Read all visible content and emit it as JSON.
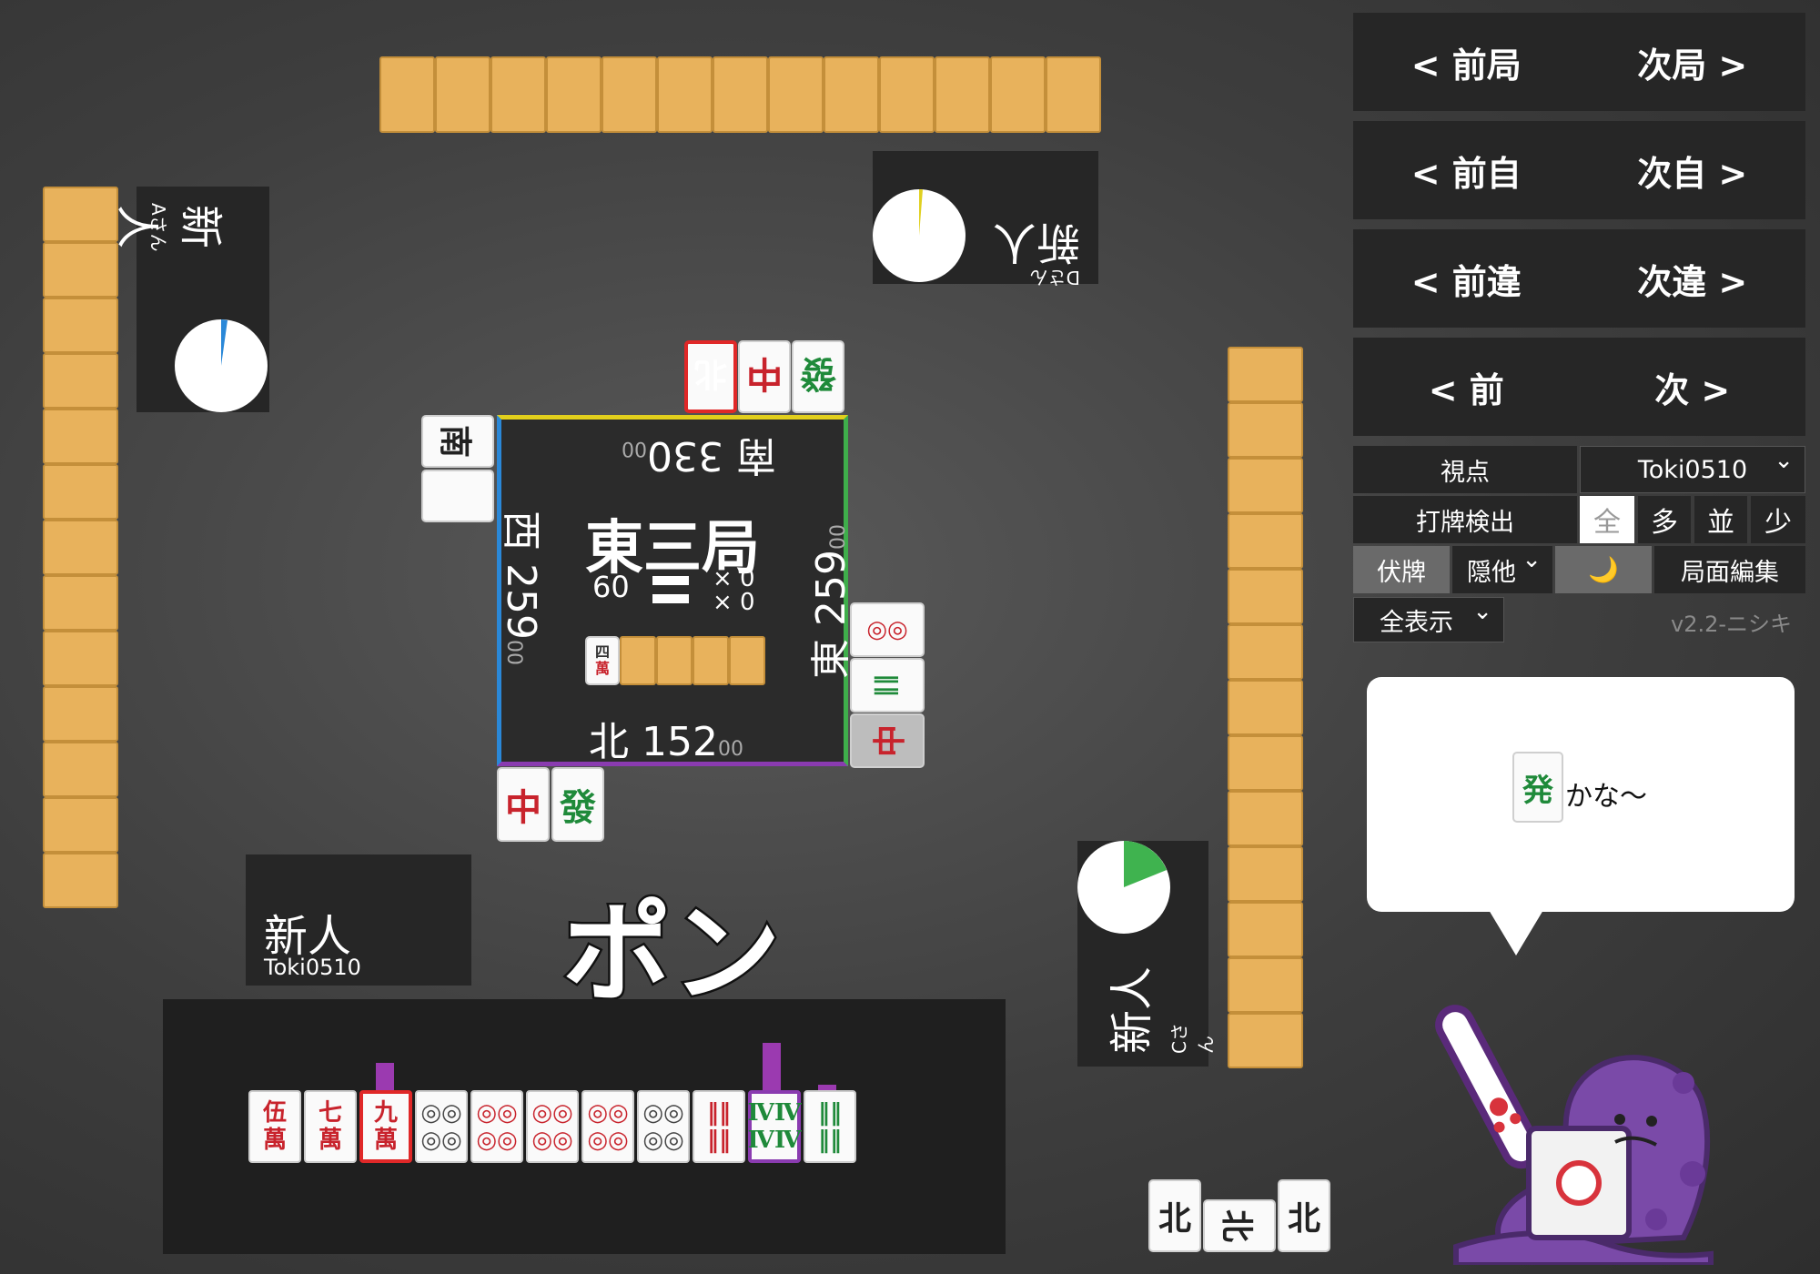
{
  "controls": {
    "prev_round": "< 前局",
    "next_round": "次局 >",
    "prev_self": "< 前自",
    "next_self": "次自 >",
    "prev_diff": "< 前違",
    "next_diff": "次違 >",
    "prev": "< 前",
    "next": "次 >",
    "viewpoint_label": "視点",
    "viewpoint_value": "Toki0510",
    "detect_label": "打牌検出",
    "detect_options": [
      "全",
      "多",
      "並",
      "少"
    ],
    "hidden_tiles": "伏牌",
    "hide_others": "隠他",
    "night_mode_icon": "🌙",
    "edit": "局面編集",
    "display_mode": "全表示",
    "version": "v2.2-ニシキ"
  },
  "speech": {
    "tile": "発",
    "text": "かな〜"
  },
  "table": {
    "round": "東三局",
    "honba": "60",
    "counter_a": "× 0",
    "counter_b": "× 0",
    "dora_tile": "四萬",
    "scores": {
      "south": {
        "wind": "南",
        "main": "330",
        "sub": "00"
      },
      "west": {
        "wind": "西",
        "main": "259",
        "sub": "00"
      },
      "east": {
        "wind": "東",
        "main": "259",
        "sub": "00"
      },
      "north": {
        "wind": "北",
        "main": "152",
        "sub": "00"
      }
    }
  },
  "players": {
    "self": {
      "rank": "新人",
      "name": "Toki0510"
    },
    "left": {
      "rank": "新人",
      "name": "Aさん"
    },
    "top": {
      "rank": "新人",
      "name": "Dさん"
    },
    "right": {
      "rank": "新人",
      "name": "Cさん"
    }
  },
  "call_text": "ポン",
  "hand": [
    {
      "top": "伍",
      "bot": "萬",
      "color": "#c8232c"
    },
    {
      "top": "七",
      "bot": "萬",
      "color": "#c8232c"
    },
    {
      "top": "九",
      "bot": "萬",
      "color": "#c8232c"
    },
    {
      "top": "◎◎",
      "bot": "◎◎",
      "color": "#444"
    },
    {
      "top": "◎◎",
      "bot": "◎◎",
      "color": "#c8232c"
    },
    {
      "top": "◎◎",
      "bot": "◎◎",
      "color": "#c8232c"
    },
    {
      "top": "◎◎",
      "bot": "◎◎",
      "color": "#c8232c"
    },
    {
      "top": "◎◎",
      "bot": "◎◎",
      "color": "#444"
    },
    {
      "top": "‖‖",
      "bot": "‖‖",
      "color": "#c8232c"
    },
    {
      "top": "ⅣⅣ",
      "bot": "ⅣⅣ",
      "color": "#1f8a3a"
    },
    {
      "top": "‖‖",
      "bot": "‖‖",
      "color": "#1f8a3a"
    }
  ],
  "discards": {
    "top_river": [
      "北",
      "中",
      "發"
    ],
    "left_river": [
      "南"
    ],
    "bottom_river": [
      "中",
      "發"
    ],
    "right_river": [
      "◎◎",
      "‖‖",
      "中"
    ],
    "north_meld": [
      "北",
      "北",
      "北"
    ]
  }
}
